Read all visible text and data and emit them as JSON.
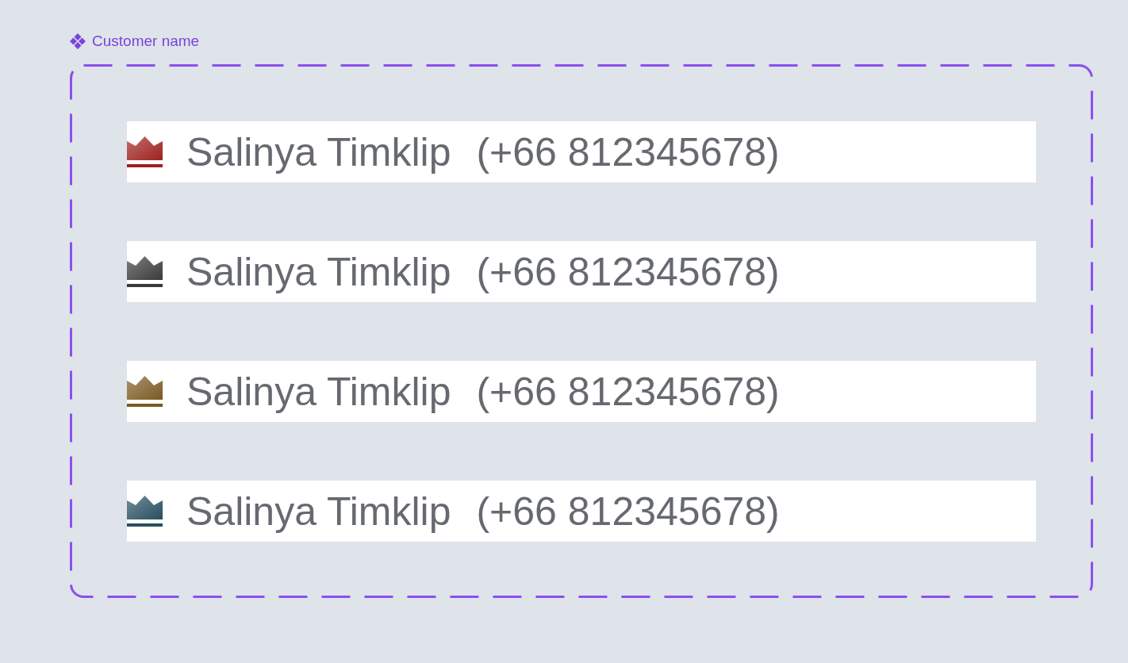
{
  "component_label": {
    "text": "Customer name"
  },
  "customers": [
    {
      "name": "Salinya Timklip",
      "phone": "(+66 812345678)",
      "color": "#9e211e"
    },
    {
      "name": "Salinya Timklip",
      "phone": "(+66 812345678)",
      "color": "#3a3a3a"
    },
    {
      "name": "Salinya Timklip",
      "phone": "(+66 812345678)",
      "color": "#7a5a22"
    },
    {
      "name": "Salinya Timklip",
      "phone": "(+66 812345678)",
      "color": "#284f60"
    }
  ]
}
